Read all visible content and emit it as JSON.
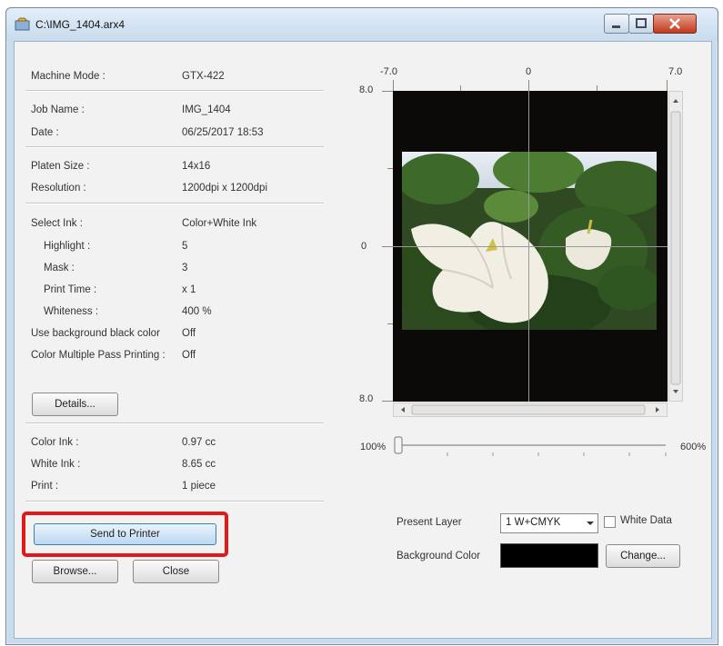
{
  "window": {
    "title": "C:\\IMG_1404.arx4"
  },
  "info": {
    "machine_mode_label": "Machine Mode :",
    "machine_mode_value": "GTX-422",
    "job_name_label": "Job Name :",
    "job_name_value": "IMG_1404",
    "date_label": "Date :",
    "date_value": "06/25/2017 18:53",
    "platen_label": "Platen Size :",
    "platen_value": "14x16",
    "resolution_label": "Resolution :",
    "resolution_value": "1200dpi x 1200dpi",
    "select_ink_label": "Select Ink :",
    "select_ink_value": "Color+White Ink",
    "highlight_label": "Highlight :",
    "highlight_value": "5",
    "mask_label": "Mask :",
    "mask_value": "3",
    "print_time_label": "Print Time :",
    "print_time_value": "x 1",
    "whiteness_label": "Whiteness :",
    "whiteness_value": "400 %",
    "bg_black_label": "Use background black color",
    "bg_black_value": "Off",
    "multi_pass_label": "Color Multiple Pass Printing :",
    "multi_pass_value": "Off",
    "color_ink_label": "Color Ink :",
    "color_ink_value": "0.97 cc",
    "white_ink_label": "White Ink :",
    "white_ink_value": "8.65 cc",
    "print_label": "Print :",
    "print_value": "1 piece"
  },
  "buttons": {
    "details": "Details...",
    "send_to_printer": "Send to Printer",
    "browse": "Browse...",
    "close": "Close",
    "change": "Change..."
  },
  "preview": {
    "x_left": "-7.0",
    "x_center": "0",
    "x_right": "7.0",
    "y_top": "8.0",
    "y_center": "0",
    "y_bottom": "8.0",
    "zoom_min": "100%",
    "zoom_max": "600%",
    "zoom_level_fraction": 0.0
  },
  "layer": {
    "present_layer_label": "Present Layer",
    "present_layer_value": "1 W+CMYK",
    "white_data_label": "White Data",
    "white_data_checked": false,
    "background_color_label": "Background Color",
    "background_color": "#000000"
  },
  "colors": {
    "highlight_border": "#e01a1a",
    "canvas_bg": "#0c0a08"
  }
}
